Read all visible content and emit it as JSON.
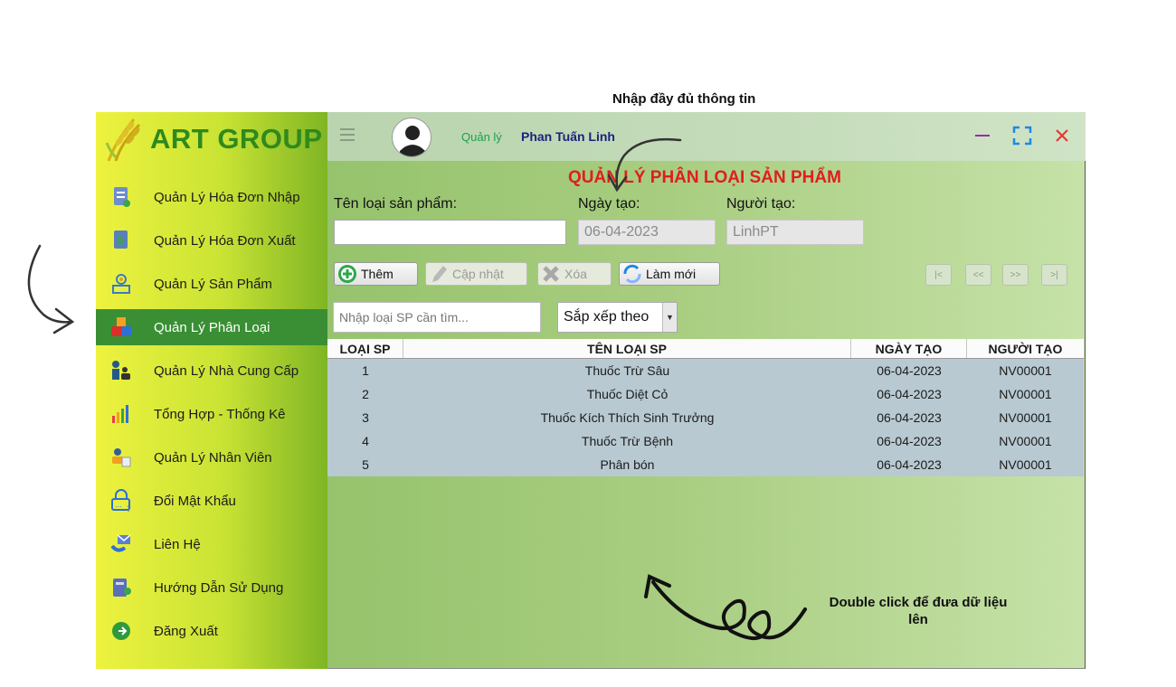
{
  "annotations": {
    "top_note": "Nhập đầy đủ thông tin",
    "double_click_note": "Double click để đưa dữ liệu lên"
  },
  "brand": {
    "name": "ART GROUP"
  },
  "sidebar": {
    "items": [
      {
        "label": "Quản Lý Hóa Đơn Nhập",
        "icon": "import-invoice-icon"
      },
      {
        "label": "Quản Lý Hóa Đơn Xuất",
        "icon": "export-invoice-icon"
      },
      {
        "label": "Quản Lý Sản Phẩm",
        "icon": "product-gear-icon"
      },
      {
        "label": "Quản Lý Phân Loại",
        "icon": "category-blocks-icon",
        "active": true
      },
      {
        "label": "Quản Lý Nhà Cung Cấp",
        "icon": "supplier-people-icon"
      },
      {
        "label": "Tổng Hợp - Thống Kê",
        "icon": "bar-chart-icon"
      },
      {
        "label": "Quản Lý Nhân Viên",
        "icon": "employee-card-icon"
      },
      {
        "label": "Đổi Mật Khẩu",
        "icon": "lock-password-icon"
      },
      {
        "label": "Liên Hệ",
        "icon": "contact-mail-icon"
      },
      {
        "label": "Hướng Dẫn Sử Dụng",
        "icon": "manual-book-icon"
      },
      {
        "label": "Đăng Xuất",
        "icon": "logout-icon"
      }
    ]
  },
  "header": {
    "role": "Quản lý",
    "user_name": "Phan Tuấn Linh"
  },
  "form": {
    "title": "QUẢN LÝ PHÂN LOẠI SẢN PHẨM",
    "name_label": "Tên loại sản phẩm:",
    "name_value": "",
    "date_label": "Ngày tạo:",
    "date_value": "06-04-2023",
    "creator_label": "Người tạo:",
    "creator_value": "LinhPT"
  },
  "toolbar": {
    "add": "Thêm",
    "update": "Cập nhật",
    "delete": "Xóa",
    "refresh": "Làm mới",
    "nav": [
      "|<",
      "<<",
      ">>",
      ">|"
    ]
  },
  "search": {
    "placeholder": "Nhập loại SP cần tìm...",
    "sort_label": "Sắp xếp theo"
  },
  "table": {
    "headers": [
      "LOẠI SP",
      "TÊN LOẠI SP",
      "NGÀY TẠO",
      "NGƯỜI TẠO"
    ],
    "rows": [
      [
        "1",
        "Thuốc Trừ Sâu",
        "06-04-2023",
        "NV00001"
      ],
      [
        "2",
        "Thuốc Diệt Cỏ",
        "06-04-2023",
        "NV00001"
      ],
      [
        "3",
        "Thuốc Kích Thích Sinh Trưởng",
        "06-04-2023",
        "NV00001"
      ],
      [
        "4",
        "Thuốc Trừ Bệnh",
        "06-04-2023",
        "NV00001"
      ],
      [
        "5",
        "Phân bón",
        "06-04-2023",
        "NV00001"
      ]
    ]
  },
  "colors": {
    "title_red": "#e11d1d",
    "active_menu": "#3a8f34",
    "brand_green": "#2e8a1c",
    "user_navy": "#1a237e"
  }
}
